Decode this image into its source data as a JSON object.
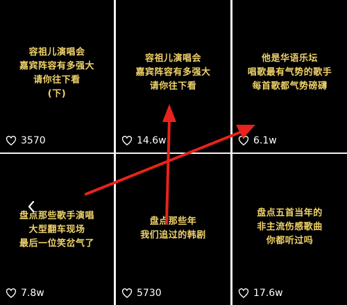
{
  "tiles": [
    {
      "caption": [
        "容祖儿演唱会",
        "嘉宾阵容有多强大",
        "请你往下看",
        "(下)"
      ],
      "likes": "3570"
    },
    {
      "caption": [
        "容祖儿演唱会",
        "嘉宾阵容有多强大",
        "请你往下看"
      ],
      "likes": "14.6w"
    },
    {
      "caption": [
        "他是华语乐坛",
        "唱歌最有气势的歌手",
        "每首歌都气势磅礴"
      ],
      "likes": "6.1w"
    },
    {
      "caption": [
        "盘点那些歌手演唱",
        "大型翻车现场",
        "最后一位笑岔气了"
      ],
      "likes": "7.8w"
    },
    {
      "caption": [
        "盘点那些年",
        "我们追过的韩剧"
      ],
      "likes": "5730"
    },
    {
      "caption": [
        "盘点五首当年的",
        "非主流伤感歌曲",
        "你都听过吗"
      ],
      "likes": "17.6w"
    }
  ],
  "colors": {
    "caption": "#f0d26a",
    "arrow": "#e8221c"
  },
  "icons": {
    "like": "heart-outline-icon",
    "back": "chevron-left-icon"
  }
}
